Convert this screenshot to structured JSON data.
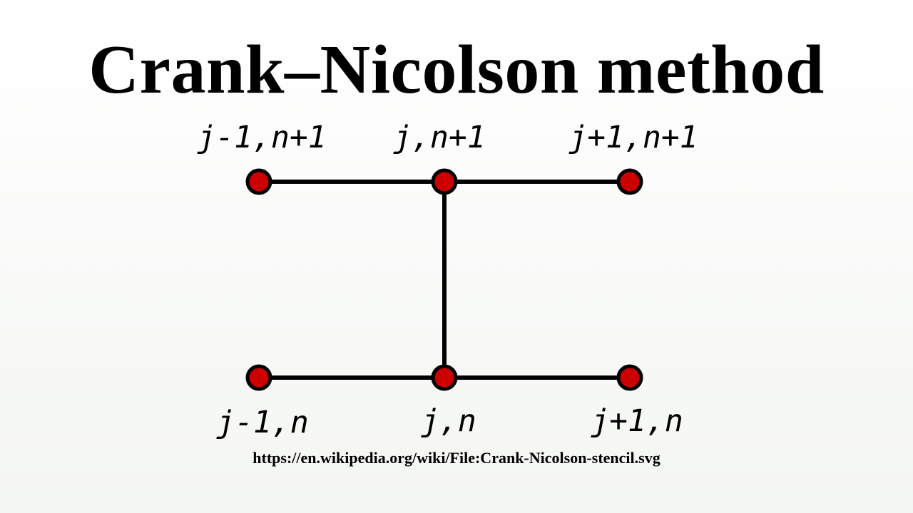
{
  "title": "Crank–Nicolson method",
  "stencil": {
    "node_fill": "#cc0000",
    "node_stroke": "#000000",
    "edge_color": "#000000",
    "labels": {
      "top_left": "j-1,n+1",
      "top_center": "j,n+1",
      "top_right": "j+1,n+1",
      "bottom_left": "j-1,n",
      "bottom_center": "j,n",
      "bottom_right": "j+1,n"
    }
  },
  "source_url": "https://en.wikipedia.org/wiki/File:Crank-Nicolson-stencil.svg"
}
